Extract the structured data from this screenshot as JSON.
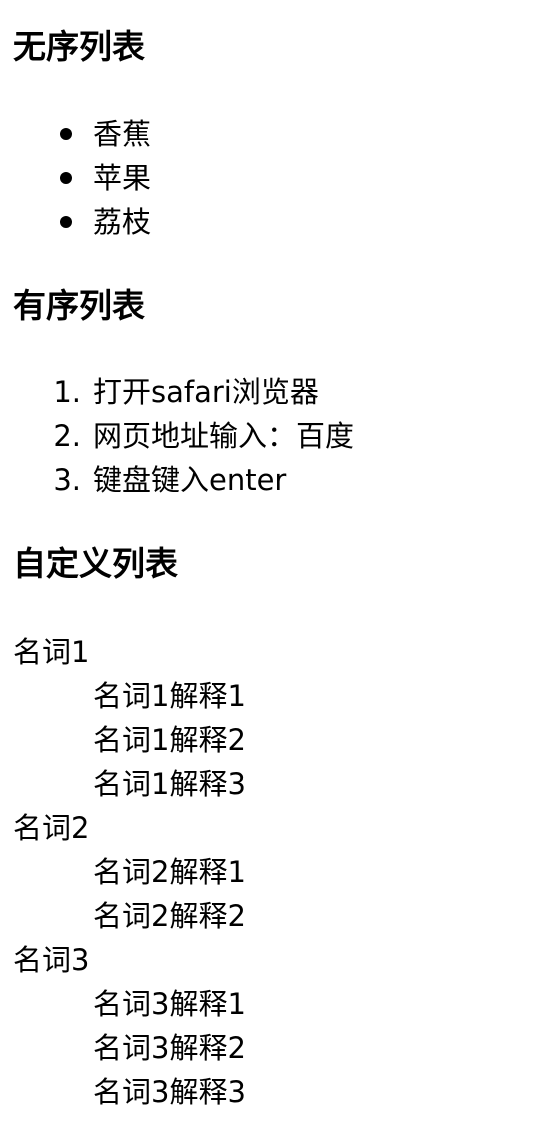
{
  "unordered": {
    "title": "无序列表",
    "items": [
      "香蕉",
      "苹果",
      "荔枝"
    ]
  },
  "ordered": {
    "title": "有序列表",
    "items": [
      {
        "num": "1.",
        "text": "打开safari浏览器"
      },
      {
        "num": "2.",
        "text": "网页地址输入：百度"
      },
      {
        "num": "3.",
        "text": "键盘键入enter"
      }
    ]
  },
  "definition": {
    "title": "自定义列表",
    "terms": [
      {
        "term": "名词1",
        "defs": [
          "名词1解释1",
          "名词1解释2",
          "名词1解释3"
        ]
      },
      {
        "term": "名词2",
        "defs": [
          "名词2解释1",
          "名词2解释2"
        ]
      },
      {
        "term": "名词3",
        "defs": [
          "名词3解释1",
          "名词3解释2",
          "名词3解释3"
        ]
      }
    ]
  }
}
